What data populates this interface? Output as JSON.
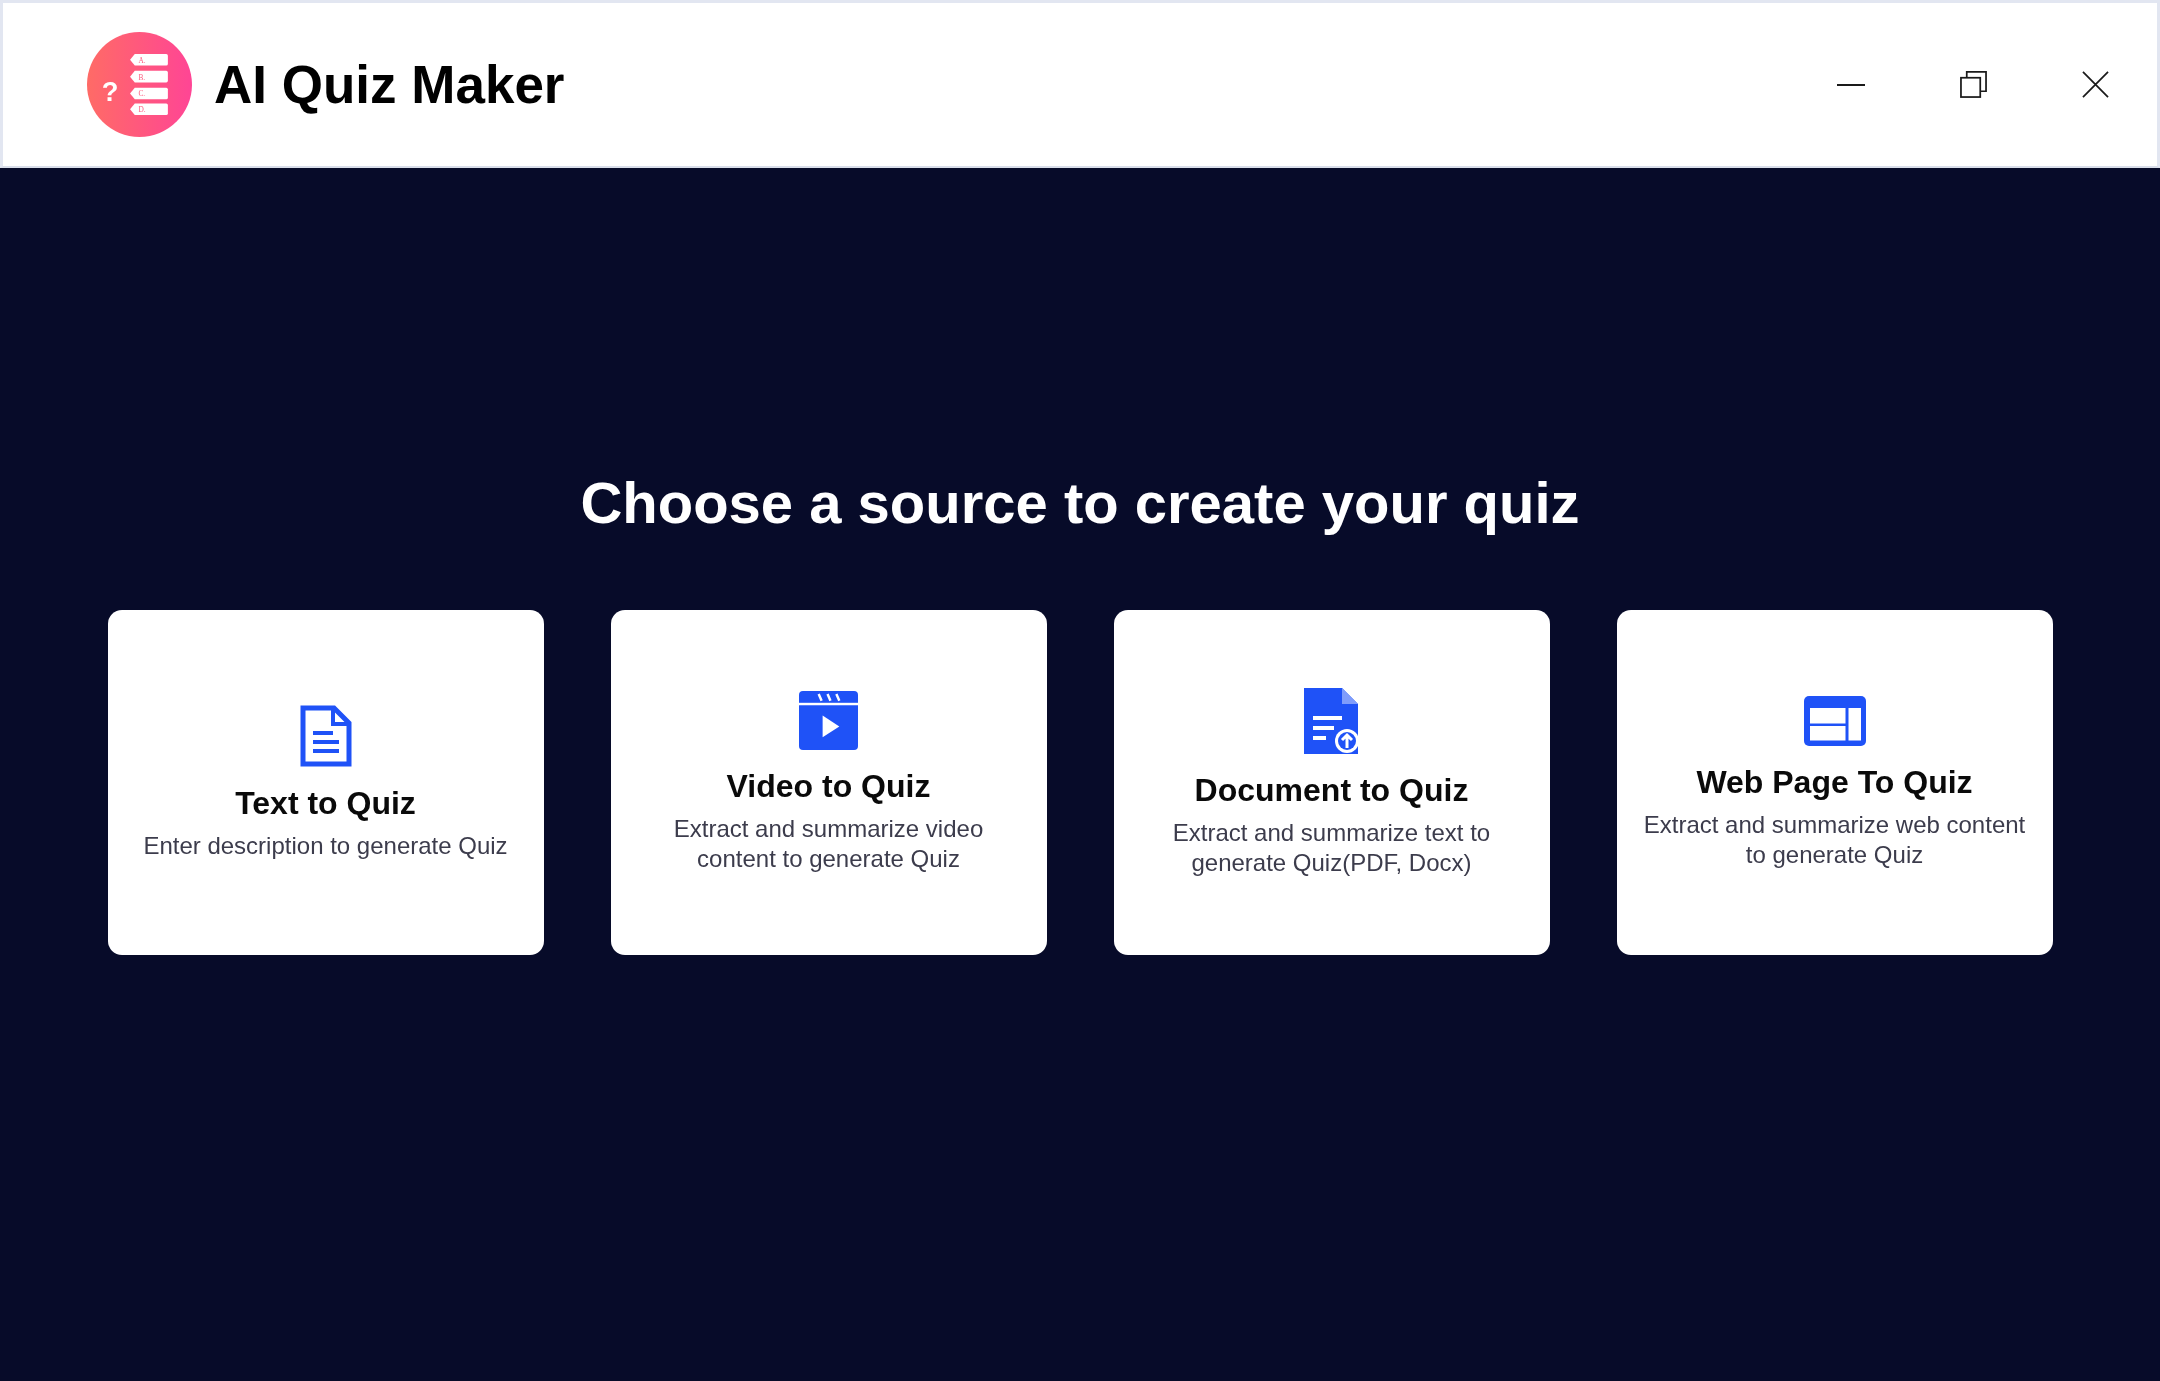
{
  "app": {
    "logo": {
      "mark": "?",
      "options": [
        "A.",
        "B.",
        "C.",
        "D."
      ]
    },
    "title": "AI Quiz Maker"
  },
  "heading": "Choose a source to create your quiz",
  "sources": [
    {
      "kind": "text",
      "title": "Text to Quiz",
      "description": "Enter description to generate Quiz"
    },
    {
      "kind": "video",
      "title": "Video to Quiz",
      "description": "Extract and summarize video content to generate Quiz"
    },
    {
      "kind": "document",
      "title": "Document to Quiz",
      "description": "Extract and summarize text to generate Quiz(PDF, Docx)"
    },
    {
      "kind": "webpage",
      "title": "Web Page To Quiz",
      "description": "Extract and summarize web content to generate Quiz"
    }
  ]
}
